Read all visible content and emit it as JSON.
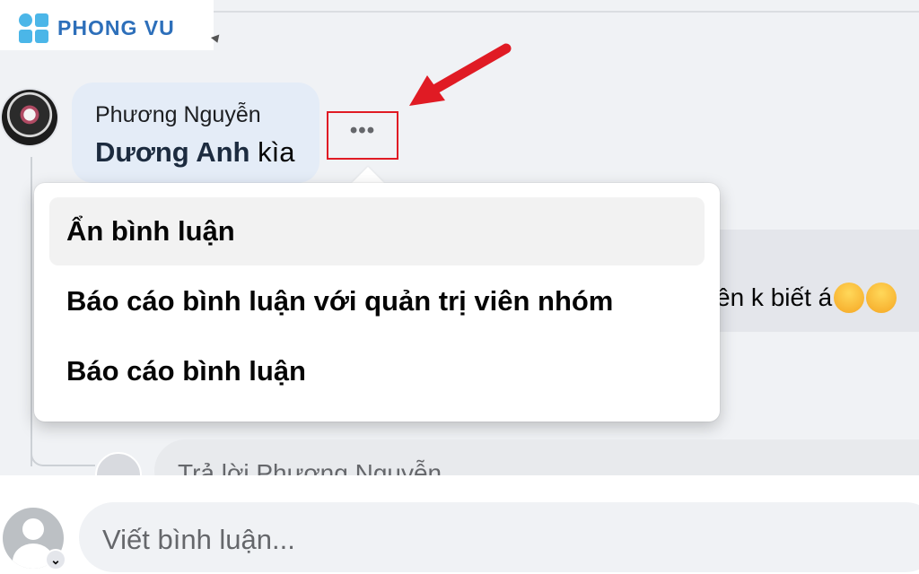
{
  "brand": {
    "logo_text": "PHONG VU"
  },
  "comment": {
    "author": "Phương Nguyễn",
    "mention": "Dương Anh",
    "text_after_mention": " kìa",
    "more_button": "•••"
  },
  "context_menu": {
    "items": [
      {
        "label": "Ẩn bình luận"
      },
      {
        "label": "Báo cáo bình luận với quản trị viên nhóm"
      },
      {
        "label": "Báo cáo bình luận"
      }
    ]
  },
  "background_comment": {
    "text": "ên k biết á"
  },
  "reply_box": {
    "placeholder": "Trả lời Phương Nguyễn..."
  },
  "composer": {
    "placeholder": "Viết bình luận...",
    "avatar_caret": "⌄"
  },
  "colors": {
    "highlight": "#e01b24",
    "bubble": "#e4ecf7",
    "logo": "#2d6fba",
    "logo_mark": "#4bb6e8"
  }
}
